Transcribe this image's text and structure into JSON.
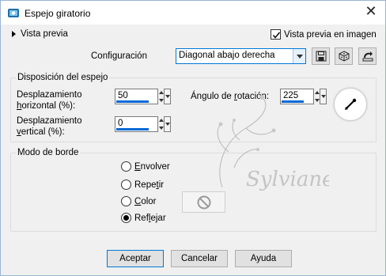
{
  "window": {
    "title": "Espejo giratorio",
    "close_glyph": "✕"
  },
  "preview": {
    "toggle_label": "Vista previa",
    "checkbox_label": "Vista previa en imagen",
    "checked": true
  },
  "config": {
    "label": "Configuración",
    "selected": "Diagonal abajo derecha",
    "tools": [
      "save-icon",
      "dice-icon",
      "preset-manage-icon"
    ]
  },
  "mirror_group": {
    "legend": "Disposición del espejo",
    "h_offset_label_1": "Desplazamiento",
    "h_offset_label_2a": "h",
    "h_offset_label_2b": "orizontal (%):",
    "h_offset_value": "50",
    "v_offset_label_1": "Desplazamiento",
    "v_offset_label_2a": "v",
    "v_offset_label_2b": "ertical (%):",
    "v_offset_value": "0",
    "rotation_label_a": "Ángulo de ",
    "rotation_label_b": "r",
    "rotation_label_c": "otación:",
    "rotation_value": "225"
  },
  "border_group": {
    "legend": "Modo de borde",
    "options": [
      {
        "pre": "",
        "u": "E",
        "post": "nvolver",
        "selected": false
      },
      {
        "pre": "Repe",
        "u": "t",
        "post": "ir",
        "selected": false
      },
      {
        "pre": "",
        "u": "C",
        "post": "olor",
        "selected": false
      },
      {
        "pre": "Ref",
        "u": "l",
        "post": "ejar",
        "selected": true
      }
    ]
  },
  "watermark_text": "Sylviane",
  "buttons": {
    "ok": "Aceptar",
    "cancel": "Cancelar",
    "help": "Ayuda"
  },
  "colors": {
    "accent": "#0078d7",
    "slider_fill": "#0068d6"
  }
}
